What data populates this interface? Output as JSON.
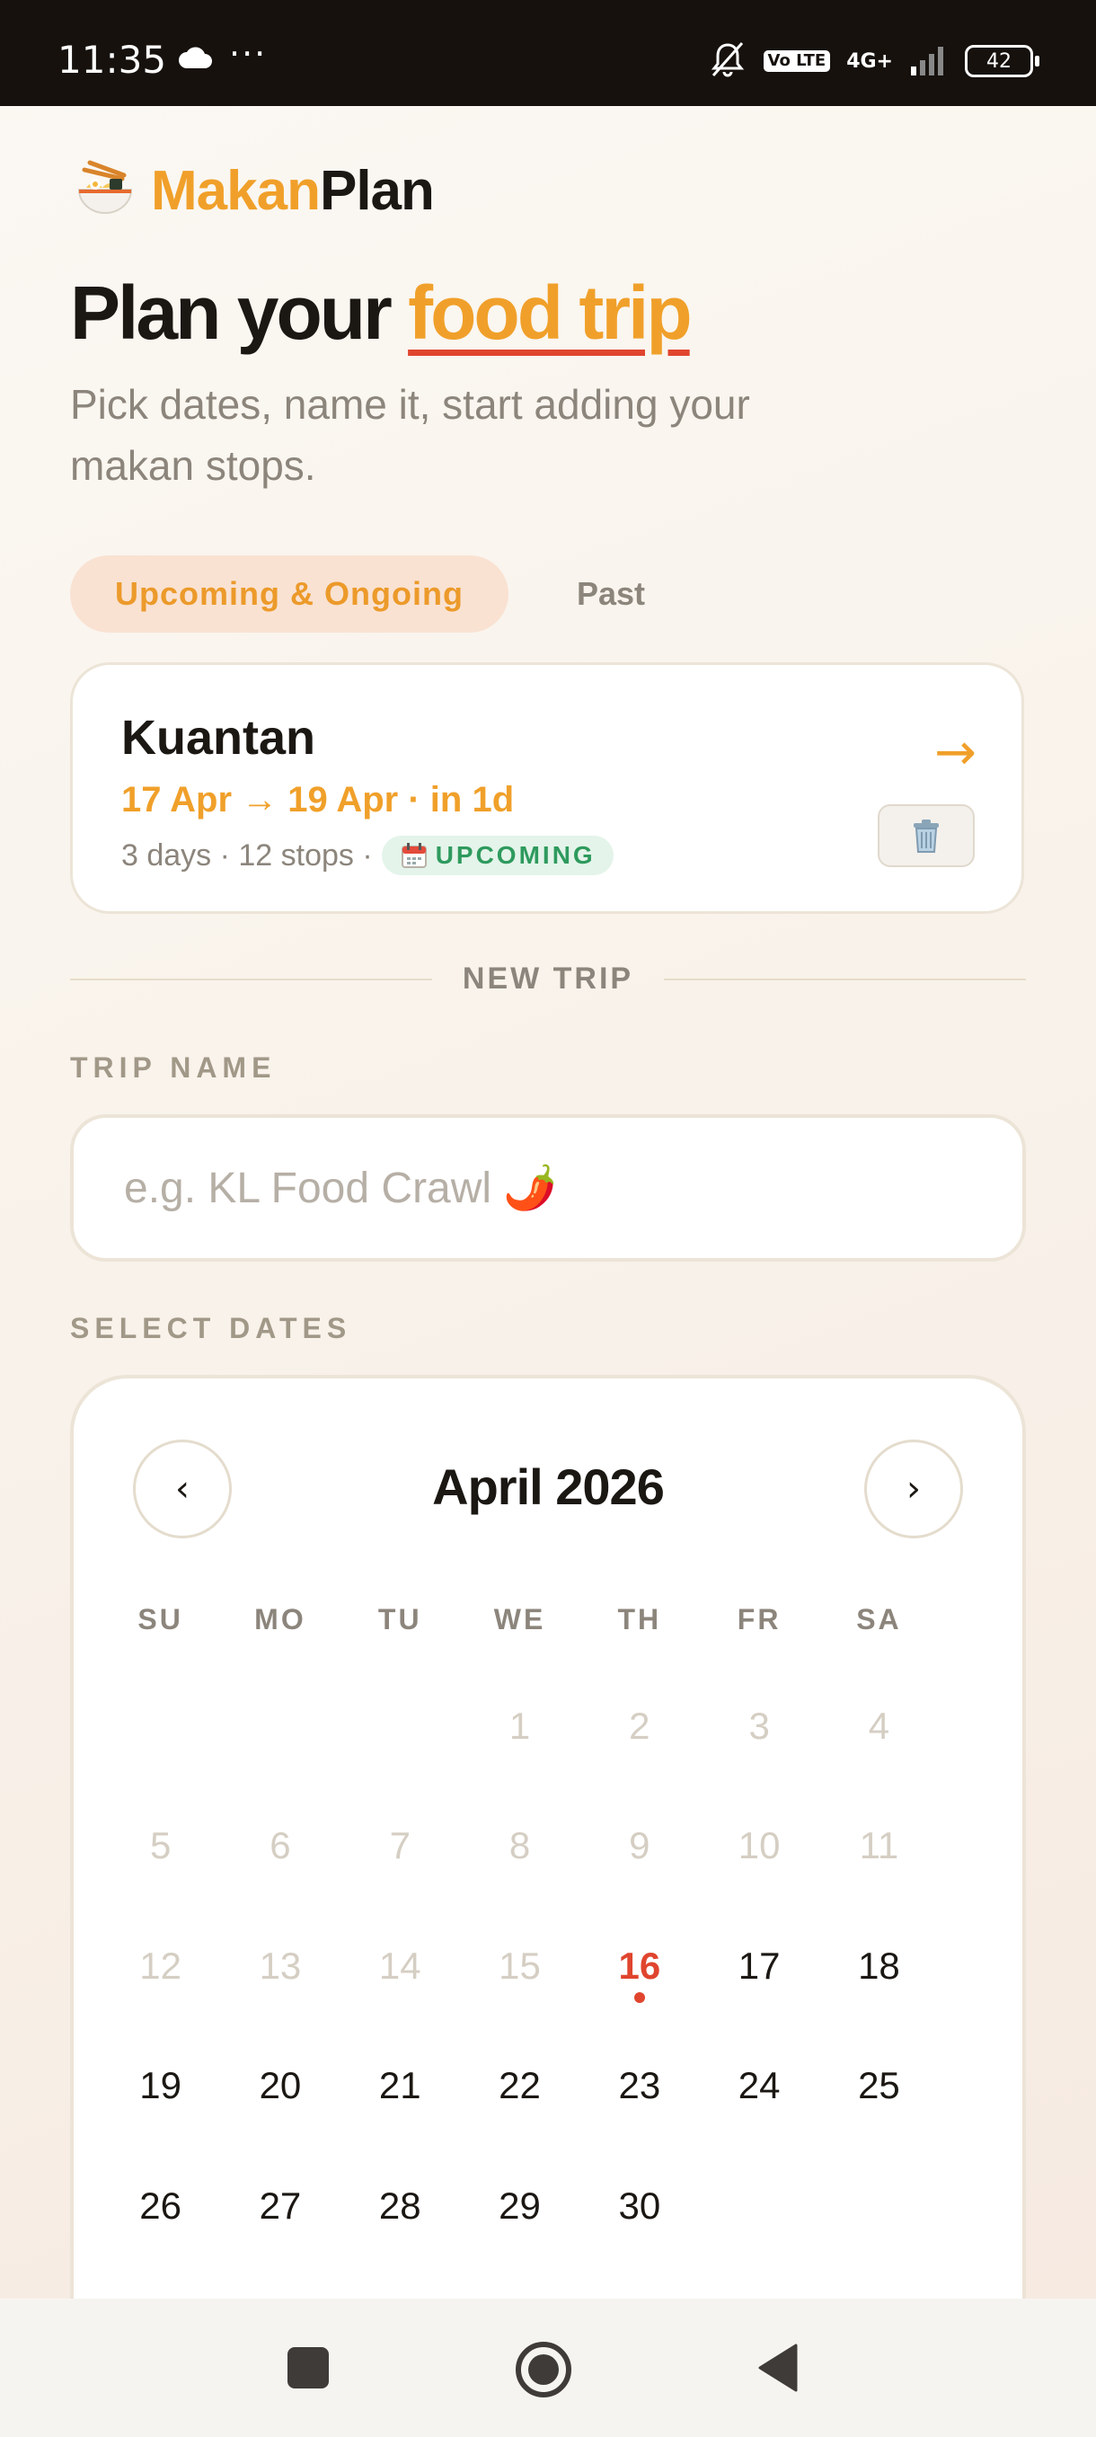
{
  "status_bar": {
    "time": "11:35",
    "more": "···",
    "volte": "Vo LTE",
    "network": "4G+",
    "battery": "42"
  },
  "brand": {
    "name_part1": "Makan",
    "name_part2": "Plan"
  },
  "hero": {
    "title_prefix": "Plan your ",
    "title_highlight": "food trip",
    "subtitle": "Pick dates, name it, start adding your makan stops."
  },
  "tabs": [
    {
      "label": "Upcoming & Ongoing",
      "active": true
    },
    {
      "label": "Past",
      "active": false
    }
  ],
  "trip": {
    "name": "Kuantan",
    "dates": "17 Apr → 19 Apr · in 1d",
    "meta": "3 days · 12 stops ·",
    "badge": "UPCOMING",
    "open_icon": "→"
  },
  "new_trip": {
    "divider_label": "NEW TRIP",
    "name_label": "TRIP NAME",
    "name_placeholder": "e.g. KL Food Crawl 🌶️",
    "dates_label": "SELECT DATES"
  },
  "calendar": {
    "month_title": "April 2026",
    "prev": "‹",
    "next": "›",
    "weekdays": [
      "SU",
      "MO",
      "TU",
      "WE",
      "TH",
      "FR",
      "SA"
    ],
    "leading_blanks": 3,
    "days_in_month": 30,
    "today": 16,
    "past_days_through": 15
  },
  "colors": {
    "accent": "#f0a02a",
    "today": "#e0452e",
    "badge_text": "#2e9a5d"
  }
}
